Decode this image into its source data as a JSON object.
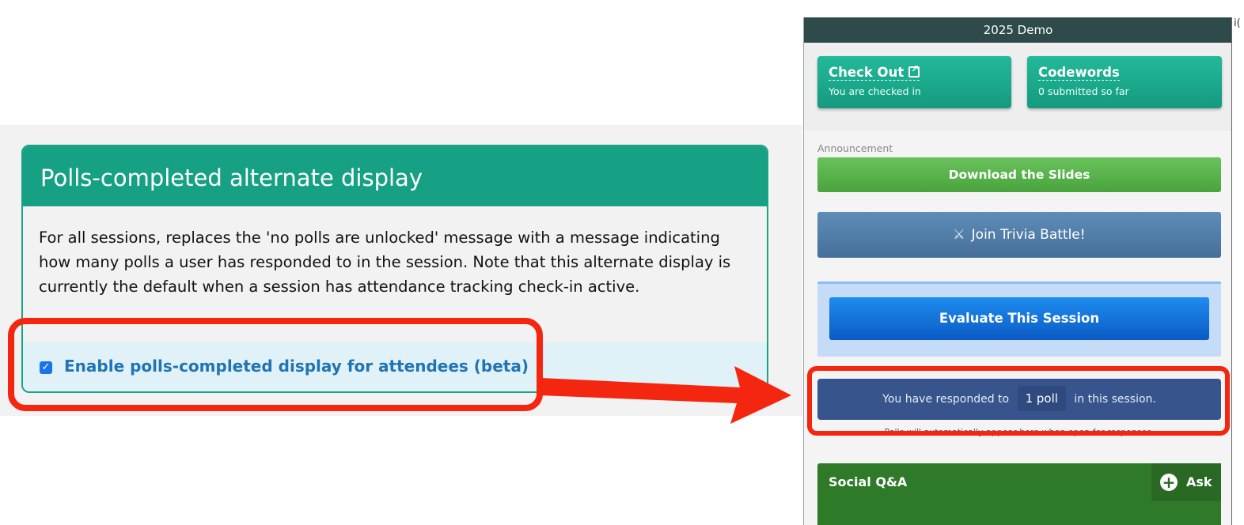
{
  "settings_card": {
    "title": "Polls-completed alternate display",
    "description": "For all sessions, replaces the 'no polls are unlocked' message with a message indicating how many polls a user has responded to in the session. Note that this alternate display is currently the default when a session has attendance tracking check-in active.",
    "checkbox_checked": true,
    "checkbox_label": "Enable polls-completed display for attendees (beta)"
  },
  "phone": {
    "title": "2025 Demo",
    "tiles": [
      {
        "title": "Check Out",
        "subtitle": "You are checked in",
        "icon": "external-link-icon"
      },
      {
        "title": "Codewords",
        "subtitle": "0 submitted so far"
      }
    ],
    "announcement_label": "Announcement",
    "download_button": "Download the Slides",
    "trivia_button": "Join Trivia Battle!",
    "trivia_icon": "crossed-swords-icon",
    "evaluate_button": "Evaluate This Session",
    "poll_status": {
      "prefix": "You have responded to",
      "count": "1 poll",
      "suffix": "in this session."
    },
    "poll_note": "Polls will automatically appear here when open for responses.",
    "social_qa": {
      "title": "Social Q&A",
      "ask_label": "Ask",
      "ask_icon": "plus-circle-icon"
    },
    "edge_glyph": "i("
  },
  "colors": {
    "teal": "#17a184",
    "callout_red": "#f5260f",
    "poll_bar": "#37558c",
    "checkbox_label": "#1f74b4"
  }
}
